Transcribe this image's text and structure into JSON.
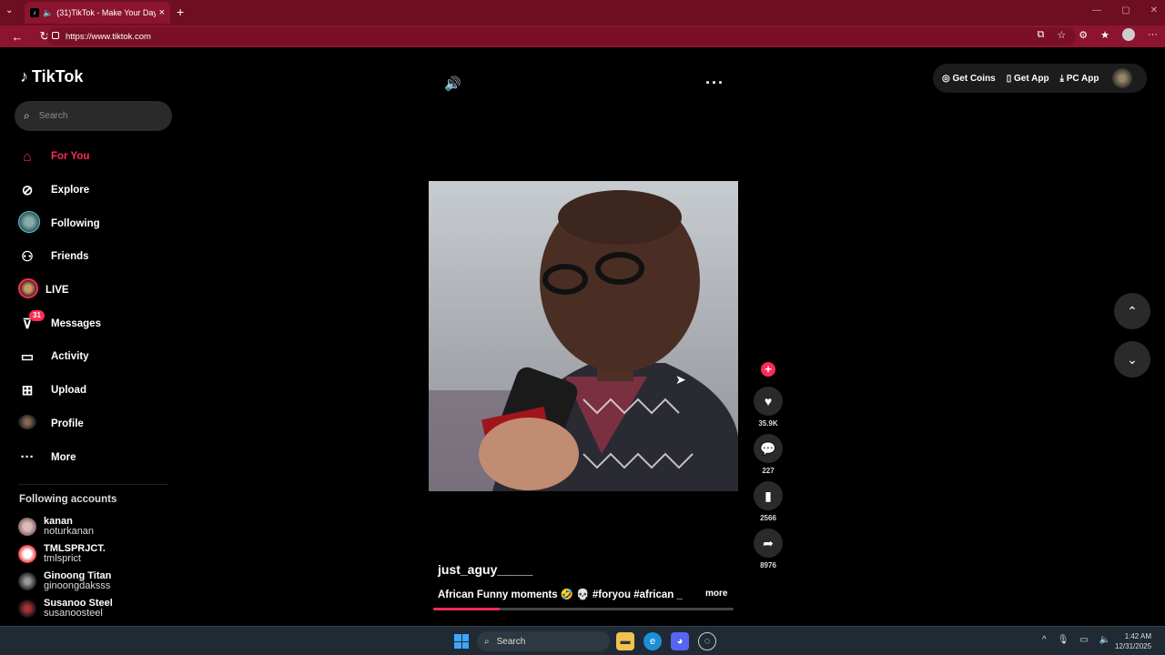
{
  "browser": {
    "tab_title": "(31)TikTok - Make Your Day",
    "url": "https://www.tiktok.com"
  },
  "tiktok": {
    "logo": "TikTok",
    "search_placeholder": "Search",
    "nav": [
      {
        "label": "For You",
        "icon": "home-icon",
        "active": true
      },
      {
        "label": "Explore",
        "icon": "compass-icon"
      },
      {
        "label": "Following",
        "icon": "following-avatar-icon"
      },
      {
        "label": "Friends",
        "icon": "friends-icon"
      },
      {
        "label": "LIVE",
        "icon": "live-avatar-icon"
      },
      {
        "label": "Messages",
        "icon": "messages-icon",
        "badge": "31"
      },
      {
        "label": "Activity",
        "icon": "activity-icon"
      },
      {
        "label": "Upload",
        "icon": "upload-icon"
      },
      {
        "label": "Profile",
        "icon": "profile-avatar-icon"
      },
      {
        "label": "More",
        "icon": "more-icon"
      }
    ],
    "following_title": "Following accounts",
    "following": [
      {
        "name": "kanan",
        "user": "noturkanan"
      },
      {
        "name": "TMLSPRJCT.",
        "user": "tmlsprict"
      },
      {
        "name": "Ginoong Titan",
        "user": "ginoongdaksss"
      },
      {
        "name": "Susanoo Steel",
        "user": "susanoosteel"
      }
    ],
    "top_buttons": {
      "coins": "Get Coins",
      "app": "Get App",
      "pc": "PC App"
    },
    "video": {
      "author": "just_aguy_____",
      "caption": "African Funny moments 🤣 💀 #foryou #african _",
      "more": "more",
      "progress": 0.22
    },
    "actions": {
      "likes": "35.9K",
      "comments": "227",
      "saves": "2566",
      "shares": "8976"
    }
  },
  "taskbar": {
    "search": "Search",
    "time": "1:42 AM",
    "date": "12/31/2025"
  },
  "colors": {
    "accent": "#fe2c55",
    "chrome": "#8c1430"
  }
}
